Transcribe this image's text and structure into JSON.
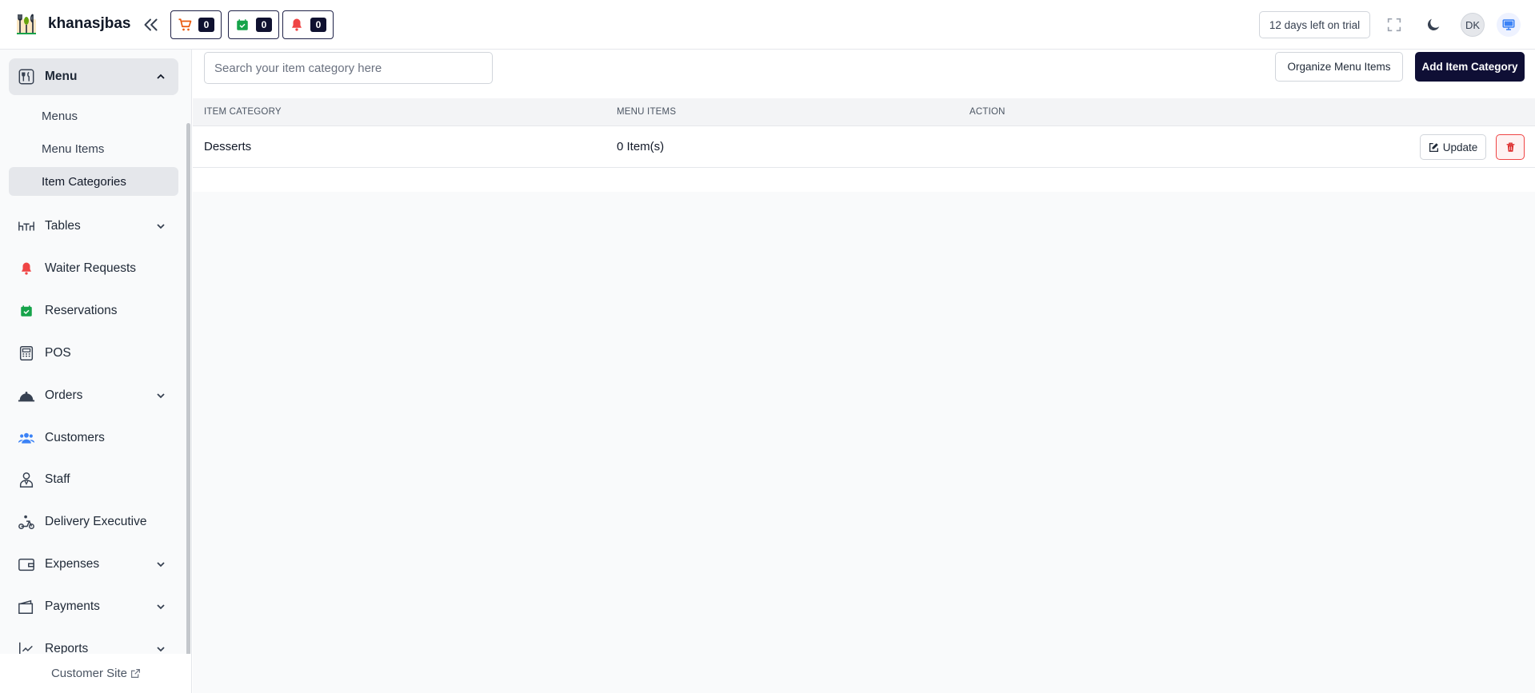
{
  "header": {
    "brand": "khanasjbas",
    "counters": [
      {
        "icon": "cart-icon",
        "count": "0",
        "color": "#ea580c"
      },
      {
        "icon": "calendar-check-icon",
        "count": "0",
        "color": "#16a34a"
      },
      {
        "icon": "bell-icon",
        "count": "0",
        "color": "#ef4444"
      }
    ],
    "trial_text": "12 days left on trial",
    "avatar_initials": "DK"
  },
  "sidebar": {
    "menu": {
      "label": "Menu",
      "sub_items": [
        "Menus",
        "Menu Items",
        "Item Categories"
      ],
      "active_sub": "Item Categories"
    },
    "items": [
      {
        "label": "Tables",
        "icon": "table-icon",
        "has_chevron": true
      },
      {
        "label": "Waiter Requests",
        "icon": "bell-icon",
        "has_chevron": false
      },
      {
        "label": "Reservations",
        "icon": "calendar-check-icon",
        "has_chevron": false
      },
      {
        "label": "POS",
        "icon": "pos-icon",
        "has_chevron": false
      },
      {
        "label": "Orders",
        "icon": "cloche-icon",
        "has_chevron": true
      },
      {
        "label": "Customers",
        "icon": "users-icon",
        "has_chevron": false
      },
      {
        "label": "Staff",
        "icon": "staff-icon",
        "has_chevron": false
      },
      {
        "label": "Delivery Executive",
        "icon": "scooter-icon",
        "has_chevron": false
      },
      {
        "label": "Expenses",
        "icon": "wallet-icon",
        "has_chevron": true
      },
      {
        "label": "Payments",
        "icon": "payments-icon",
        "has_chevron": true
      },
      {
        "label": "Reports",
        "icon": "chart-icon",
        "has_chevron": true
      }
    ],
    "customer_site": "Customer Site"
  },
  "main": {
    "search_placeholder": "Search your item category here",
    "organize_label": "Organize Menu Items",
    "add_label": "Add Item Category",
    "columns": [
      "ITEM CATEGORY",
      "MENU ITEMS",
      "ACTION"
    ],
    "rows": [
      {
        "category": "Desserts",
        "menu_items": "0 Item(s)",
        "update_label": "Update"
      }
    ]
  },
  "colors": {
    "primary": "#0f0f35",
    "danger": "#ef4444",
    "accent_blue": "#3b82f6"
  }
}
